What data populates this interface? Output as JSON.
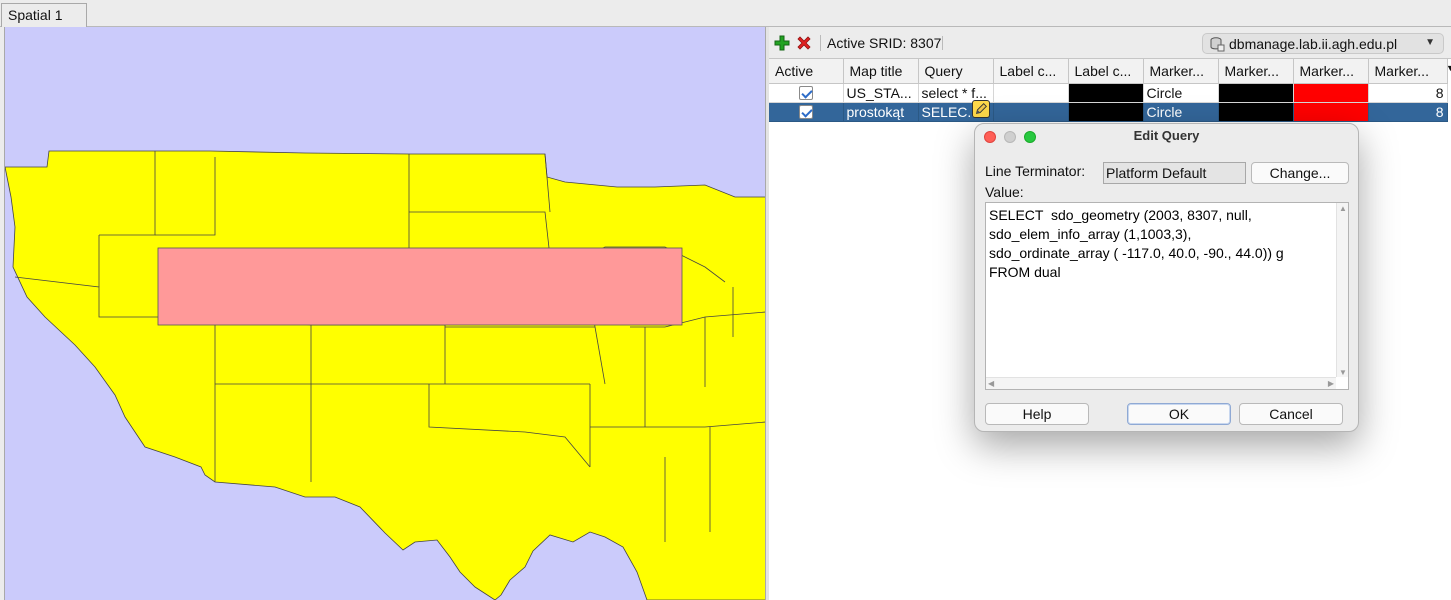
{
  "tabs": [
    {
      "label": "Spatial 1"
    }
  ],
  "map": {
    "background_color": "#cbcbfb",
    "land_color": "#ffff00",
    "rectangle_color": "#ff9999"
  },
  "toolbar": {
    "add_icon": "green-plus-icon",
    "remove_icon": "red-x-icon",
    "srid_label": "Active SRID: 8307",
    "connection": "dbmanage.lab.ii.agh.edu.pl"
  },
  "table": {
    "columns": [
      "Active",
      "Map title",
      "Query",
      "Label c...",
      "Label c...",
      "Marker...",
      "Marker...",
      "Marker...",
      "Marker..."
    ],
    "rows": [
      {
        "title": "US_STA...",
        "query": "select * f...",
        "marker_shape": "Circle",
        "marker_size": "8",
        "selected": false
      },
      {
        "title": "prostokąt",
        "query": "SELEC...",
        "marker_shape": "Circle",
        "marker_size": "8",
        "selected": true
      }
    ]
  },
  "dialog": {
    "title": "Edit Query",
    "line_terminator_label": "Line Terminator:",
    "line_terminator_value": "Platform Default",
    "change_button": "Change...",
    "value_label": "Value:",
    "query_text": "SELECT  sdo_geometry (2003, 8307, null,\nsdo_elem_info_array (1,1003,3),\nsdo_ordinate_array ( -117.0, 40.0, -90., 44.0)) g\nFROM dual",
    "help_button": "Help",
    "ok_button": "OK",
    "cancel_button": "Cancel"
  }
}
